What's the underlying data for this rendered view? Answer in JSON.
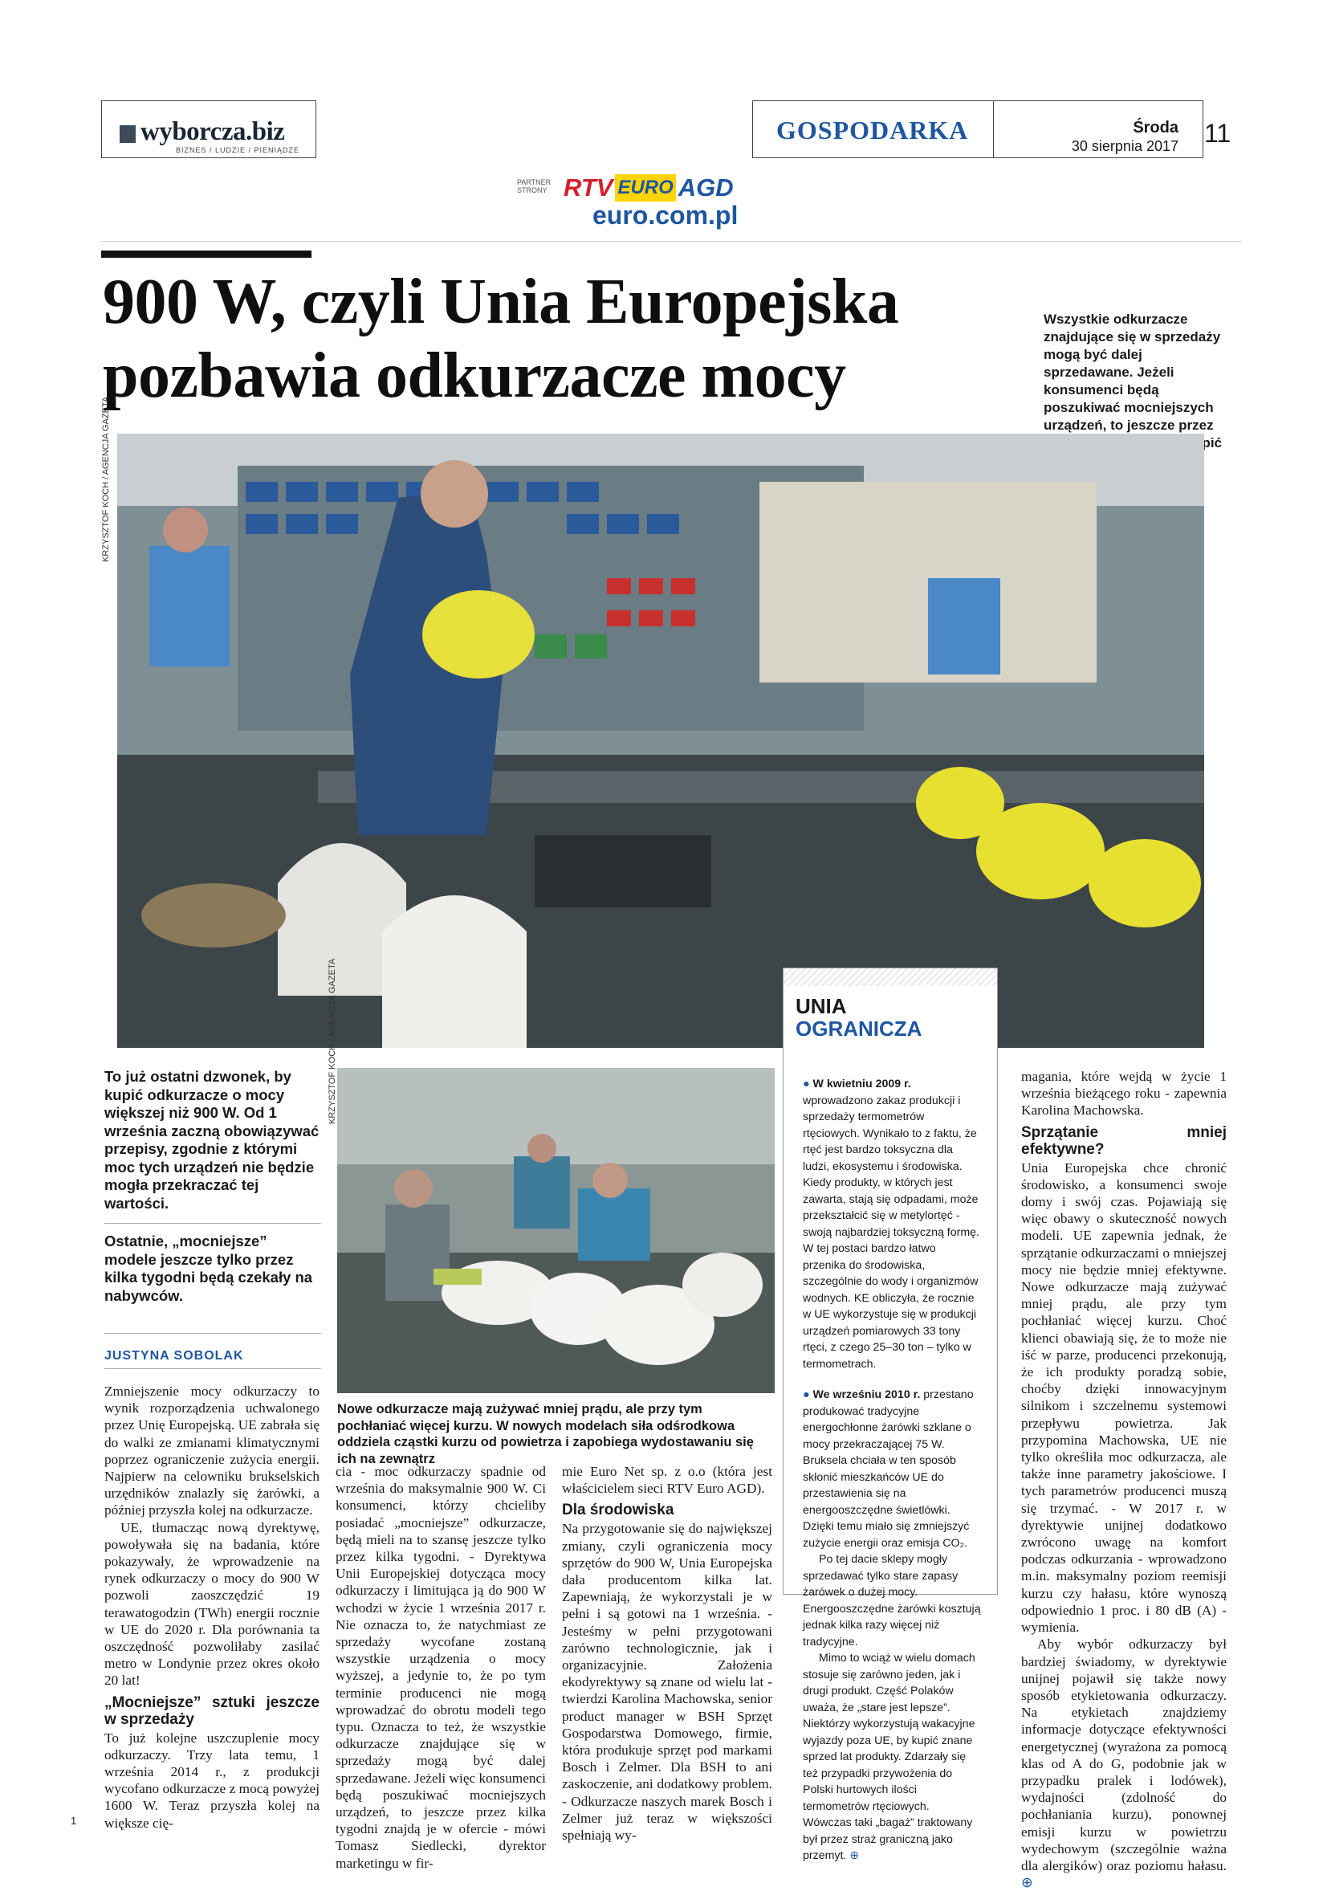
{
  "header": {
    "logo": "wyborcza.biz",
    "logo_sub": "BIZNES / LUDZIE / PIENIĄDZE",
    "section": "GOSPODARKA",
    "day": "Środa",
    "date": "30 sierpnia 2017",
    "page": "11",
    "partner_label_1": "PARTNER",
    "partner_label_2": "STRONY",
    "partner_rtv": "RTV",
    "partner_euro": "EURO",
    "partner_agd": "AGD",
    "partner_url": "euro.com.pl"
  },
  "article": {
    "title_1": "900 W, czyli Unia Europejska",
    "title_2": "pozbawia odkurzacze mocy",
    "lead_side": "Wszystkie odkurzacze znajdujące się w sprzedaży mogą być dalej sprzedawane. Jeżeli konsumenci będą poszukiwać mocniejszych urządzeń, to jeszcze przez kilka tygodni mogą je kupić",
    "photo_credit_1": "KRZYSZTOF KOCH / AGENCJA GAZETA",
    "photo_credit_2": "KRZYSZTOF KOCH / AGENCJA GAZETA",
    "intro_1": "To już ostatni dzwonek, by kupić odkurzacze o mocy większej niż 900 W. Od 1 września zaczną obowiązywać przepisy, zgodnie z którymi moc tych urządzeń nie będzie mogła przekraczać tej wartości.",
    "intro_2": "Ostatnie, „mocniejsze” modele jeszcze tylko przez kilka tygodni będą czekały na nabywców.",
    "author": "JUSTYNA SOBOLAK",
    "caption_2": "Nowe odkurzacze mają zużywać mniej prądu, ale przy tym pochłaniać więcej kurzu. W nowych modelach siła odśrodkowa oddziela cząstki kurzu od powietrza i zapobiega wydostawaniu się ich na zewnątrz",
    "col1_p1": "Zmniejszenie mocy odkurzaczy to wynik rozporządzenia uchwalonego przez Unię Europejską. UE zabrała się do walki ze zmianami klimatycznymi poprzez ograniczenie zużycia energii. Najpierw na celowniku brukselskich urzędników znalazły się żarówki, a później przyszła kolej na odkurzacze.",
    "col1_p2": "UE, tłumacząc nową dyrektywę, powoływała się na badania, które pokazywały, że wprowadzenie na rynek odkurzaczy o mocy do 900 W pozwoli zaoszczędzić 19 terawatogodzin (TWh) energii rocznie w UE do 2020 r. Dla porównania ta oszczędność pozwoliłaby zasilać metro w Londynie przez okres około 20 lat!",
    "col1_h": "„Mocniejsze” sztuki jeszcze w sprzedaży",
    "col1_p3": "To już kolejne uszczuplenie mocy odkurzaczy. Trzy lata temu, 1 września 2014 r., z produkcji wycofano odkurzacze z mocą powyżej 1600 W. Teraz przyszła kolej na większe cię-",
    "col2_p1": "cia - moc odkurzaczy spadnie od września do maksymalnie 900 W. Ci konsumenci, którzy chcieliby posiadać „mocniejsze” odkurzacze, będą mieli na to szansę jeszcze tylko przez kilka tygodni. - Dyrektywa Unii Europejskiej dotycząca mocy odkurzaczy i limitująca ją do 900 W wchodzi w życie 1 września 2017 r. Nie oznacza to, że natychmiast ze sprzedaży wycofane zostaną wszystkie urządzenia o mocy wyższej, a jedynie to, że po tym terminie producenci nie mogą wprowadzać do obrotu modeli tego typu. Oznacza to też, że wszystkie odkurzacze znajdujące się w sprzedaży mogą być dalej sprzedawane. Jeżeli więc konsumenci będą poszukiwać mocniejszych urządzeń, to jeszcze przez kilka tygodni znajdą je w ofercie - mówi Tomasz Siedlecki, dyrektor marketingu w fir-",
    "col3_p1": "mie Euro Net sp. z o.o (która jest właścicielem sieci RTV Euro AGD).",
    "col3_h": "Dla środowiska",
    "col3_p2": "Na przygotowanie się do największej zmiany, czyli ograniczenia mocy sprzętów do 900 W, Unia Europejska dała producentom kilka lat. Zapewniają, że wykorzystali je w pełni i są gotowi na 1 września. - Jesteśmy w pełni przygotowani zarówno technologicznie, jak i organizacyjnie. Założenia ekodyrektywy są znane od wielu lat - twierdzi Karolina Machowska, senior product manager w BSH Sprzęt Gospodarstwa Domowego, firmie, która produkuje sprzęt pod markami Bosch i Zelmer. Dla BSH to ani zaskoczenie, ani dodatkowy problem. - Odkurzacze naszych marek Bosch i Zelmer już teraz w większości spełniają wy-",
    "col4_p1": "magania, które wejdą w życie 1 września bieżącego roku - zapewnia Karolina Machowska.",
    "col4_h": "Sprzątanie mniej efektywne?",
    "col4_p2": "Unia Europejska chce chronić środowisko, a konsumenci swoje domy i swój czas. Pojawiają się więc obawy o skuteczność nowych modeli. UE zapewnia jednak, że sprzątanie odkurzaczami o mniejszej mocy nie będzie mniej efektywne. Nowe odkurzacze mają zużywać mniej prądu, ale przy tym pochłaniać więcej kurzu. Choć klienci obawiają się, że to może nie iść w parze, producenci przekonują, że ich produkty poradzą sobie, choćby dzięki innowacyjnym silnikom i szczelnemu systemowi przepływu powietrza. Jak przypomina Machowska, UE nie tylko określiła moc odkurzacza, ale także inne parametry jakościowe. I tych parametrów producenci muszą się trzymać. - W 2017 r. w dyrektywie unijnej dodatkowo zwrócono uwagę na komfort podczas odkurzania - wprowadzono m.in. maksymalny poziom reemisji kurzu czy hałasu, które wynoszą odpowiednio 1 proc. i 80 dB (A) - wymienia.",
    "col4_p3": "Aby wybór odkurzaczy był bardziej świadomy, w dyrektywie unijnej pojawił się także nowy sposób etykietowania odkurzaczy. Na etykietach znajdziemy informacje dotyczące efektywności energetycznej (wyrażona za pomocą klas od A do G, podobnie jak w przypadku pralek i lodówek), wydajności (zdolność do pochłaniania kurzu), ponownej emisji kurzu w powietrzu wydechowym (szczególnie ważna dla alergików) oraz poziomu hałasu.",
    "footer_left": "1"
  },
  "box": {
    "title_1": "UNIA",
    "title_2": "OGRANICZA",
    "b1_lead": "W kwietniu 2009 r.",
    "b1_text": "wprowadzono zakaz produkcji i sprzedaży termometrów rtęciowych. Wynikało to z faktu, że rtęć jest bardzo toksyczna dla ludzi, ekosystemu i środowiska. Kiedy produkty, w których jest zawarta, stają się odpadami, może przekształcić się w metylortęć - swoją najbardziej toksyczną formę. W tej postaci bardzo łatwo przenika do środowiska, szczególnie do wody i organizmów wodnych. KE obliczyła, że rocznie w UE wykorzystuje się w produkcji urządzeń pomiarowych 33 tony rtęci, z czego 25–30 ton – tylko w termometrach.",
    "b2_lead": "We wrześniu 2010 r.",
    "b2_text": "przestano produkować tradycyjne energochłonne żarówki szklane o mocy przekraczającej 75 W. Bruksela chciała w ten sposób skłonić mieszkańców UE do przestawienia się na energooszczędne świetlówki. Dzięki temu miało się zmniejszyć zużycie energii oraz emisja CO₂.",
    "b2_p2": "Po tej dacie sklepy mogły sprzedawać tylko stare zapasy żarówek o dużej mocy. Energooszczędne żarówki kosztują jednak kilka razy więcej niż tradycyjne.",
    "b2_p3": "Mimo to wciąż w wielu domach stosuje się zarówno jeden, jak i drugi produkt. Część Polaków uważa, że „stare jest lepsze”. Niektórzy wykorzystują wakacyjne wyjazdy poza UE, by kupić znane sprzed lat produkty. Zdarzały się też przypadki przywożenia do Polski hurtowych ilości termometrów rtęciowych. Wówczas taki „bagaż” traktowany był przez straż graniczną jako przemyt."
  },
  "colors": {
    "accent": "#1e56a0",
    "rtv_red": "#d4202c",
    "euro_blue": "#1e56a0",
    "agd_yellow": "#ffd400"
  }
}
